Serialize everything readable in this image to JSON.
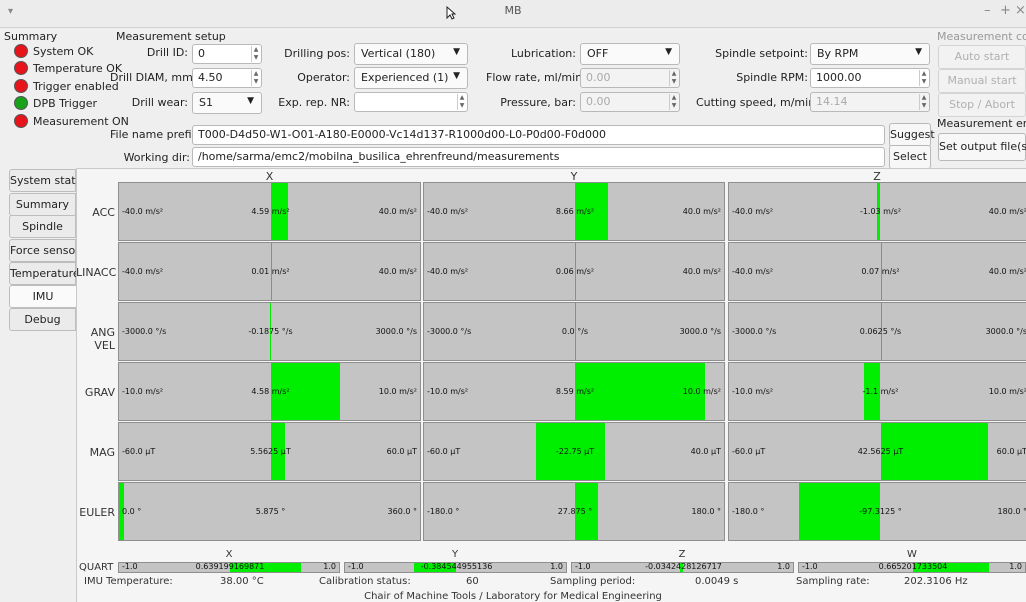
{
  "window": {
    "title": "MB",
    "min": "–",
    "max": "+",
    "close": "×",
    "menu_arrow": "▾"
  },
  "summary": {
    "title": "Summary",
    "items": [
      {
        "label": "System OK",
        "color": "#e8141b"
      },
      {
        "label": "Temperature OK",
        "color": "#e8141b"
      },
      {
        "label": "Trigger enabled",
        "color": "#e8141b"
      },
      {
        "label": "DPB Trigger",
        "color": "#19a119"
      },
      {
        "label": "Measurement ON",
        "color": "#e8141b"
      }
    ]
  },
  "setup": {
    "title": "Measurement setup",
    "drill_id_label": "Drill ID:",
    "drill_id_value": "0",
    "drill_diam_label": "Drill DIAM, mm:",
    "drill_diam_value": "4.50",
    "drill_wear_label": "Drill wear:",
    "drill_wear_value": "S1",
    "drilling_pos_label": "Drilling pos:",
    "drilling_pos_value": "Vertical (180)",
    "operator_label": "Operator:",
    "operator_value": "Experienced (1)",
    "exp_rep_label": "Exp. rep. NR:",
    "exp_rep_value": "",
    "lubrication_label": "Lubrication:",
    "lubrication_value": "OFF",
    "flow_rate_label": "Flow rate, ml/min:",
    "flow_rate_value": "0.00",
    "pressure_label": "Pressure, bar:",
    "pressure_value": "0.00",
    "spindle_setpoint_label": "Spindle setpoint:",
    "spindle_setpoint_value": "By RPM",
    "spindle_rpm_label": "Spindle RPM:",
    "spindle_rpm_value": "1000.00",
    "cutting_speed_label": "Cutting speed, m/min:",
    "cutting_speed_value": "14.14",
    "file_prefix_label": "File name prefix:",
    "file_prefix_value": "T000-D4d50-W1-O01-A180-E0000-Vc14d137-R1000d00-L0-P0d00-F0d000",
    "working_dir_label": "Working dir:",
    "working_dir_value": "/home/sarma/emc2/mobilna_busilica_ehrenfreund/measurements",
    "suggest": "Suggest",
    "select": "Select"
  },
  "control": {
    "title": "Measurement control",
    "auto_start": "Auto start",
    "manual_start": "Manual start",
    "stop": "Stop / Abort",
    "enable_title": "Measurement enable",
    "set_output": "Set output file(s)"
  },
  "tabs": [
    "System status",
    "Summary",
    "Spindle",
    "Force sensor",
    "Temperature",
    "IMU",
    "Debug"
  ],
  "active_tab": "IMU",
  "imu": {
    "columns": [
      "X",
      "Y",
      "Z"
    ],
    "rows": [
      {
        "label": "ACC",
        "cells": [
          {
            "min": "-40.0 m/s²",
            "max": "40.0 m/s²",
            "value": "4.59 m/s²",
            "from": 0,
            "to": 4.59,
            "lo": -40,
            "hi": 40
          },
          {
            "min": "-40.0 m/s²",
            "max": "40.0 m/s²",
            "value": "8.66 m/s²",
            "from": 0,
            "to": 8.66,
            "lo": -40,
            "hi": 40
          },
          {
            "min": "-40.0 m/s²",
            "max": "40.0 m/s²",
            "value": "-1.03 m/s²",
            "from": -1.03,
            "to": 0,
            "lo": -40,
            "hi": 40
          }
        ]
      },
      {
        "label": "LINACC",
        "cells": [
          {
            "min": "-40.0 m/s²",
            "max": "40.0 m/s²",
            "value": "0.01 m/s²",
            "from": 0,
            "to": 0.01,
            "lo": -40,
            "hi": 40
          },
          {
            "min": "-40.0 m/s²",
            "max": "40.0 m/s²",
            "value": "0.06 m/s²",
            "from": 0,
            "to": 0.06,
            "lo": -40,
            "hi": 40
          },
          {
            "min": "-40.0 m/s²",
            "max": "40.0 m/s²",
            "value": "0.07 m/s²",
            "from": 0,
            "to": 0.07,
            "lo": -40,
            "hi": 40
          }
        ]
      },
      {
        "label": "ANG VEL",
        "cells": [
          {
            "min": "-3000.0 °/s",
            "max": "3000.0 °/s",
            "value": "-0.1875 °/s",
            "from": -0.1875,
            "to": 0,
            "lo": -3000,
            "hi": 3000
          },
          {
            "min": "-3000.0 °/s",
            "max": "3000.0 °/s",
            "value": "0.0 °/s",
            "from": 0,
            "to": 0,
            "lo": -3000,
            "hi": 3000
          },
          {
            "min": "-3000.0 °/s",
            "max": "3000.0 °/s",
            "value": "0.0625 °/s",
            "from": 0,
            "to": 0.0625,
            "lo": -3000,
            "hi": 3000
          }
        ]
      },
      {
        "label": "GRAV",
        "cells": [
          {
            "min": "-10.0 m/s²",
            "max": "10.0 m/s²",
            "value": "4.58 m/s²",
            "from": 0,
            "to": 4.58,
            "lo": -10,
            "hi": 10
          },
          {
            "min": "-10.0 m/s²",
            "max": "10.0 m/s²",
            "value": "8.59 m/s²",
            "from": 0,
            "to": 8.59,
            "lo": -10,
            "hi": 10
          },
          {
            "min": "-10.0 m/s²",
            "max": "10.0 m/s²",
            "value": "-1.1 m/s²",
            "from": -1.1,
            "to": 0,
            "lo": -10,
            "hi": 10
          }
        ]
      },
      {
        "label": "MAG",
        "cells": [
          {
            "min": "-60.0 µT",
            "max": "60.0 µT",
            "value": "5.5625 µT",
            "from": 0,
            "to": 5.5625,
            "lo": -60,
            "hi": 60
          },
          {
            "min": "-60.0 µT",
            "max": "40.0 µT",
            "value": "-22.75 µT",
            "from": -22.75,
            "to": 0,
            "lo": -60,
            "hi": 40
          },
          {
            "min": "-60.0 µT",
            "max": "60.0 µT",
            "value": "42.5625 µT",
            "from": 0,
            "to": 42.5625,
            "lo": -60,
            "hi": 60
          }
        ]
      },
      {
        "label": "EULER",
        "cells": [
          {
            "min": "0.0 °",
            "max": "360.0 °",
            "value": "5.875 °",
            "from": 0,
            "to": 5.875,
            "lo": 0,
            "hi": 360
          },
          {
            "min": "-180.0 °",
            "max": "180.0 °",
            "value": "27.875 °",
            "from": 0,
            "to": 27.875,
            "lo": -180,
            "hi": 180
          },
          {
            "min": "-180.0 °",
            "max": "180.0 °",
            "value": "-97.3125 °",
            "from": -97.3125,
            "to": 0,
            "lo": -180,
            "hi": 180
          }
        ]
      }
    ],
    "quart": {
      "label": "QUART",
      "columns": [
        "X",
        "Y",
        "Z",
        "W"
      ],
      "cells": [
        {
          "min": "-1.0",
          "max": "1.0",
          "value": "0.639199169871",
          "from": 0,
          "to": 0.6392,
          "lo": -1,
          "hi": 1
        },
        {
          "min": "-1.0",
          "max": "1.0",
          "value": "-0.384544955136",
          "from": -0.3845,
          "to": 0,
          "lo": -1,
          "hi": 1
        },
        {
          "min": "-1.0",
          "max": "1.0",
          "value": "-0.0342428126717",
          "from": -0.0342,
          "to": 0,
          "lo": -1,
          "hi": 1
        },
        {
          "min": "-1.0",
          "max": "1.0",
          "value": "0.665201733504",
          "from": 0,
          "to": 0.6652,
          "lo": -1,
          "hi": 1
        }
      ]
    },
    "status": {
      "temp_label": "IMU Temperature:",
      "temp_value": "38.00 °C",
      "cal_label": "Calibration status:",
      "cal_value": "60",
      "period_label": "Sampling period:",
      "period_value": "0.0049 s",
      "rate_label": "Sampling rate:",
      "rate_value": "202.3106 Hz"
    }
  },
  "footer": "Chair of Machine Tools / Laboratory for Medical Engineering",
  "colors": {
    "fill": "#00ee00",
    "gauge_bg": "#c4c4c4"
  }
}
